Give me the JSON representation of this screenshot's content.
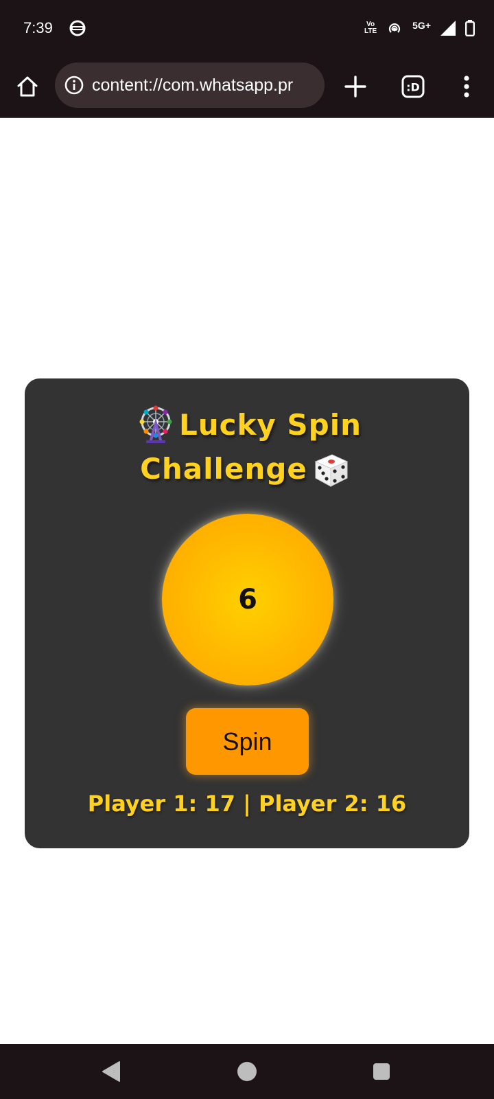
{
  "status_bar": {
    "time": "7:39",
    "volte_top": "Vo",
    "volte_bottom": "LTE",
    "network": "5G+",
    "icons": [
      "app-notification-icon",
      "hotspot-icon",
      "signal-icon",
      "battery-icon"
    ]
  },
  "browser": {
    "url": "content://com.whatsapp.pr",
    "tabs_label": ":D",
    "icons": [
      "home-icon",
      "info-icon",
      "plus-icon",
      "tab-switcher-icon",
      "more-vert-icon"
    ]
  },
  "game": {
    "title_line1": "Lucky Spin",
    "title_line2": "Challenge",
    "title_emojis": [
      "ferris-wheel-emoji",
      "die-emoji"
    ],
    "wheel_value": "6",
    "spin_label": "Spin",
    "score_text": "Player 1: 17 | Player 2: 16"
  },
  "colors": {
    "card_bg": "#333333",
    "title": "#ffd21f",
    "wheel": "#ffbb00",
    "button": "#ff9800",
    "system_bar": "#1b1316"
  },
  "nav_bar": {
    "icons": [
      "back-icon",
      "home-circle-icon",
      "recents-icon"
    ]
  }
}
